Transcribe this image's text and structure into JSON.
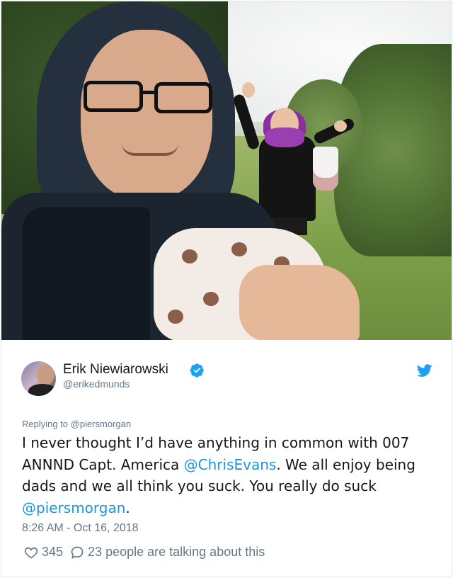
{
  "tweet": {
    "author_name": "Erik Niewiarowski",
    "author_handle": "@erikedmunds",
    "replying_to": "Replying to @piersmorgan",
    "text_parts": [
      "I never thought I’d have anything in common with 007 ANNND Capt. America ",
      "@ChrisEvans",
      ". We all enjoy being dads and we all think you suck. You really do suck ",
      "@piersmorgan",
      "."
    ],
    "timestamp": "8:26 AM - Oct 16, 2018",
    "likes": "345",
    "talking_count": "23",
    "talking_text": "people are talking about this"
  },
  "icons": {
    "verified": "verified-badge-icon",
    "bird": "twitter-bird-icon",
    "heart": "heart-icon",
    "comment": "comment-bubble-icon"
  },
  "colors": {
    "link": "#1b95e0",
    "secondary_text": "#657786",
    "border": "#e1e8ed"
  }
}
